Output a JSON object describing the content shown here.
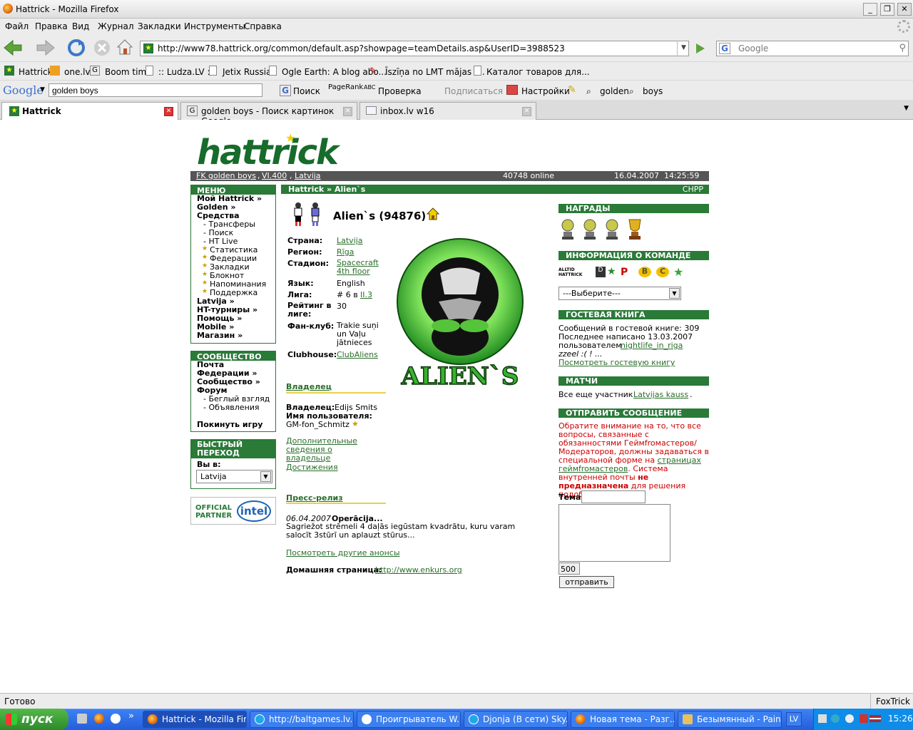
{
  "window": {
    "title": "Hattrick - Mozilla Firefox"
  },
  "menubar": [
    "Файл",
    "Правка",
    "Вид",
    "Журнал",
    "Закладки",
    "Инструменты",
    "Справка"
  ],
  "navbar": {
    "url": "http://www78.hattrick.org/common/default.asp?showpage=teamDetails.asp&UserID=3988523",
    "search_placeholder": "Google"
  },
  "bookmarks": [
    "Hattrick",
    "one.lv",
    "Boom time",
    ":: Ludza.LV ::",
    "Jetix Russia",
    "Ogle Earth: A blog abo...",
    "Īszīņa no LMT mājas l...",
    "Каталог товаров для..."
  ],
  "google_toolbar": {
    "query": "golden boys",
    "search": "Поиск",
    "pagerank": "PageRank",
    "spell": "Проверка",
    "subscribe": "Подписаться",
    "settings": "Настройки",
    "w1": "golden",
    "w2": "boys"
  },
  "tabs": [
    {
      "label": "Hattrick"
    },
    {
      "label": "golden boys - Поиск картинок Google"
    },
    {
      "label": "inbox.lv w16"
    }
  ],
  "header": {
    "team_link": "FK golden boys",
    "league_link": "VI.400",
    "country_link": "Latvija",
    "online": "40748 online",
    "datetime": "16.04.2007  14:25:59"
  },
  "menu": {
    "title": "МЕНЮ",
    "items": [
      "Мой Hattrick »",
      "Golden »",
      "Средства"
    ],
    "subitems": [
      "- Трансферы",
      "- Поиск",
      "- HT Live",
      "Статистика",
      "Федерации",
      "Закладки",
      "Блокнот",
      "Напоминания",
      "Поддержка"
    ],
    "items2": [
      "Latvija »",
      "HT-турниры »",
      "Помощь »",
      "Mobile »",
      "Магазин »"
    ]
  },
  "community": {
    "title": "СООБЩЕСТВО",
    "items": [
      "Почта",
      "Федерации »",
      "Сообщество »",
      "Форум"
    ],
    "subitems": [
      "- Беглый взгляд",
      "- Объявления"
    ],
    "leave": "Покинуть игру"
  },
  "quick": {
    "title": "БЫСТРЫЙ ПЕРЕХОД",
    "label": "Вы в:",
    "selected": "Latvija"
  },
  "partner": {
    "line1": "OFFICIAL",
    "line2": "PARTNER",
    "brand": "intel"
  },
  "breadcrumb": {
    "path": "Hattrick » Alien`s",
    "chpp": "CHPP"
  },
  "team": {
    "name": "Alien`s (94876)",
    "labels": {
      "country": "Страна:",
      "region": "Регион:",
      "stadium": "Стадион:",
      "language": "Язык:",
      "league": "Лига:",
      "rating": "Рейтинг в лиге:",
      "fanclub": "Фан-клуб:",
      "clubhouse": "Clubhouse:"
    },
    "country": "Latvija",
    "region": "Rīga",
    "stadium": "Spacecraft 4th floor",
    "language": "English",
    "league_prefix": "# 6 в",
    "league_link": "II.3",
    "rating": "30",
    "fanclub": "Trakie suņi un Vaļu jātnieces",
    "clubhouse": "ClubAliens",
    "logo_text": "ALIEN`S"
  },
  "owner": {
    "heading": "Владелец",
    "owner_label": "Владелец:",
    "owner_name": "Edijs Smits",
    "user_label": "Имя пользователя:",
    "username": "GM-fon_Schmitz",
    "more_link": "Дополнительные сведения о владельце",
    "achievements": "Достижения"
  },
  "press": {
    "heading": "Пресс-релиз",
    "date": "06.04.2007",
    "title": "Operācija...",
    "text": "Sagriežot strēmeli 4 daļās iegūstam kvadrātu, kuru varam salocīt 3stūrī un aplauzt stūrus...",
    "more": "Посмотреть другие анонсы",
    "homepage_label": "Домашняя страница:",
    "homepage": "http://www.enkurs.org"
  },
  "awards": {
    "title": "НАГРАДЫ"
  },
  "teaminfo": {
    "title": "ИНФОРМАЦИЯ О КОМАНДЕ",
    "altid1": "ALLTID",
    "altid2": "HATTRICK",
    "select": "---Выберите---"
  },
  "guestbook": {
    "title": "ГОСТЕВАЯ КНИГА",
    "count": "Сообщений в гостевой книге: 309",
    "last": "Последнее написано 13.03.2007",
    "by": "пользователем",
    "user": "nightlife_in_riga",
    "quote": "zzeel :( ! ...",
    "link": "Посмотреть гостевую книгу"
  },
  "matches": {
    "title": "МАТЧИ",
    "text": "Все еще участник",
    "cup": "Latvijas kauss"
  },
  "message": {
    "title": "ОТПРАВИТЬ СООБЩЕНИЕ",
    "note1": "Обратите внимание на то, что все вопросы, связанные с обязанностями Геймfroмастеров/Модераторов, должны задаваться в специальной форме на",
    "note_link": "страницах геймfroмастеров",
    "note2": ". Система внутренней почты",
    "note_bold": "не предназначена",
    "note3": "для решения подобных вопросов.",
    "subject_label": "Тема",
    "counter": "500",
    "send": "отправить"
  },
  "status": {
    "left": "Готово",
    "right": "FoxTrick"
  },
  "taskbar": {
    "start": "пуск",
    "items": [
      "Hattrick - Mozilla Fir...",
      "http://baltgames.lv....",
      "Проигрыватель W...",
      "Djonja (В сети) Sky...",
      "Новая тема - Разг...",
      "Безымянный - Paint"
    ],
    "lang": "LV",
    "clock": "15:26"
  }
}
